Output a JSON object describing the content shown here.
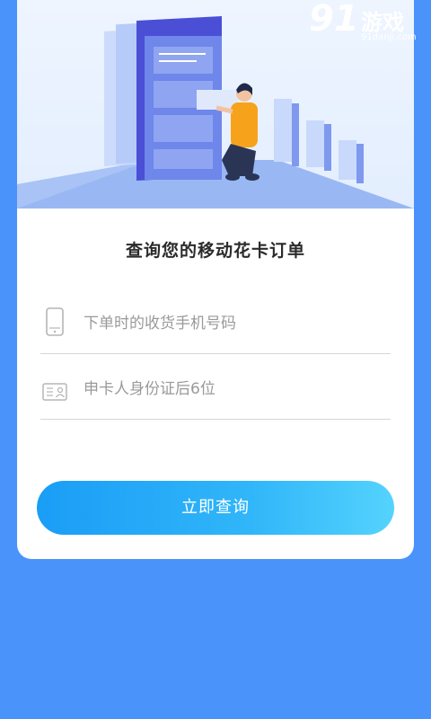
{
  "watermark": {
    "mark": "91",
    "name": "游戏",
    "url": "91danji.com"
  },
  "page": {
    "title": "查询您的移动花卡订单",
    "phone_placeholder": "下单时的收货手机号码",
    "id_placeholder": "申卡人身份证后6位",
    "submit_label": "立即查询"
  },
  "colors": {
    "background": "#4a93fb",
    "card": "#ffffff",
    "button_start": "#1a9df6",
    "button_end": "#54d3fd",
    "placeholder": "#9a9a9a"
  },
  "icons": {
    "phone": "phone-icon",
    "id_card": "id-card-icon"
  }
}
